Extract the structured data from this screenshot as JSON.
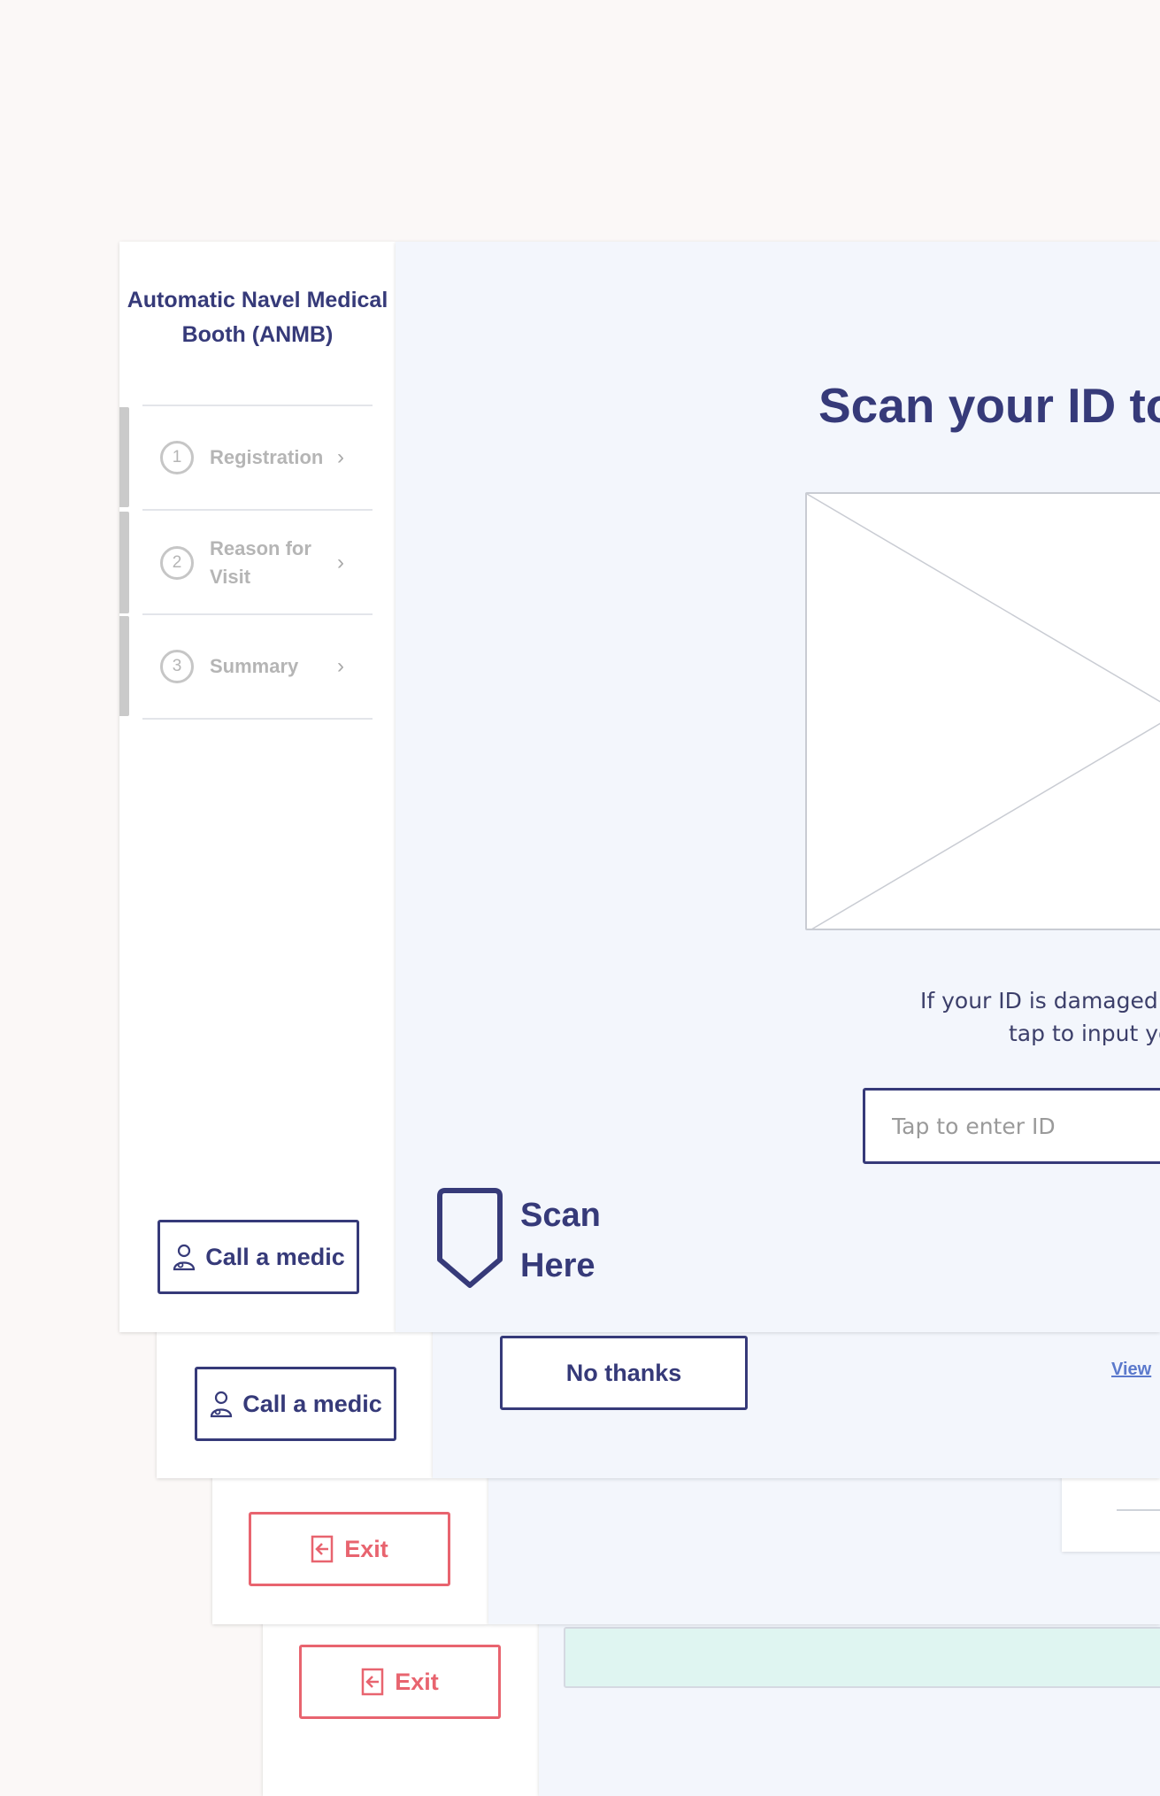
{
  "app": {
    "brand": "Automatic Navel Medical Booth (ANMB)",
    "steps": [
      {
        "number": "1",
        "label": "Registration"
      },
      {
        "number": "2",
        "label": "Reason for Visit"
      },
      {
        "number": "3",
        "label": "Summary"
      }
    ],
    "call_medic_label": "Call a medic",
    "exit_label": "Exit"
  },
  "main": {
    "title": "Scan your ID to",
    "help_line1": "If your ID is damaged an",
    "help_line2": "tap to input you",
    "id_placeholder": "Tap to enter ID",
    "scan_label": "Scan Here"
  },
  "layer2": {
    "call_medic_label": "Call a medic",
    "no_thanks_label": "No thanks",
    "view_link": "View"
  },
  "layer3": {
    "exit_label": "Exit"
  },
  "layer4": {
    "exit_label": "Exit"
  },
  "icons": {
    "medic": "medic-person-icon",
    "exit": "exit-door-icon",
    "chevron": "chevron-right-icon",
    "scan": "scan-shield-icon"
  },
  "colors": {
    "primary": "#363a79",
    "exit": "#e8646f",
    "main_bg": "#f3f6fc",
    "link": "#5b79cc"
  }
}
